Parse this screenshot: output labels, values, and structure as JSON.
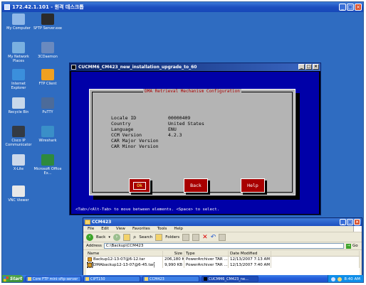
{
  "rdp": {
    "title": "172.42.1.101 - 원격 데스크톱"
  },
  "desktop_icons": [
    {
      "label": "My Computer",
      "icon": "computer-icon",
      "color": "#8fb8e8"
    },
    {
      "label": "SFTP Server.exe",
      "icon": "sftp-icon",
      "color": "#2b2b2b"
    },
    {
      "label": "My Network Places",
      "icon": "network-icon",
      "color": "#7ab0e0"
    },
    {
      "label": "3CDaemon",
      "icon": "daemon-icon",
      "color": "#6a8abf"
    },
    {
      "label": "Internet Explorer",
      "icon": "ie-icon",
      "color": "#3b8fdc"
    },
    {
      "label": "FTP Client",
      "icon": "ftp-icon",
      "color": "#f0a020"
    },
    {
      "label": "Recycle Bin",
      "icon": "recycle-bin-icon",
      "color": "#c8d8ea"
    },
    {
      "label": "PuTTY",
      "icon": "putty-icon",
      "color": "#4c6b9a"
    },
    {
      "label": "Cisco IP Communicator",
      "icon": "cisco-phone-icon",
      "color": "#333a44"
    },
    {
      "label": "Wireshark",
      "icon": "wireshark-icon",
      "color": "#3a8fc8"
    },
    {
      "label": "X-Lite",
      "icon": "xlite-icon",
      "color": "#ccd8ea"
    },
    {
      "label": "Microsoft Office Ex...",
      "icon": "excel-icon",
      "color": "#2e8a3e"
    },
    {
      "label": "VNC Viewer",
      "icon": "vnc-icon",
      "color": "#e8e8e8"
    }
  ],
  "console": {
    "title": "CUCMM6_CM423_new_installation_upgrade_to_60",
    "dialog_title": "DMA Retrieval Mechanism Configuration",
    "fields": [
      {
        "key": "Locale ID",
        "value": "00000409"
      },
      {
        "key": "Country",
        "value": "United States"
      },
      {
        "key": "Language",
        "value": "ENU"
      },
      {
        "key": "CCM Version",
        "value": "4.2.3"
      },
      {
        "key": "CAR Major Version",
        "value": ""
      },
      {
        "key": "CAR Minor Version",
        "value": ""
      }
    ],
    "buttons": {
      "ok": "Ok",
      "back": "Back",
      "help": "Help"
    },
    "footer": "<Tab>/<Alt-Tab> to move between elements. <Space> to select."
  },
  "explorer": {
    "title": "CCM423",
    "menu": [
      "File",
      "Edit",
      "View",
      "Favorites",
      "Tools",
      "Help"
    ],
    "toolbar": {
      "back": "Back",
      "search": "Search",
      "folders": "Folders"
    },
    "address_label": "Address",
    "address_value": "C:\\Backup\\CCM423",
    "go_label": "Go",
    "columns": [
      "Name",
      "Size",
      "Type",
      "Date Modified"
    ],
    "files": [
      {
        "name": "Backup12-13-07@6-12.tar",
        "size": "206,180 KB",
        "type": "PowerArchiver TAR ...",
        "date": "12/13/2007 7:13 AM"
      },
      {
        "name": "DMAbackup12-13-07@6-45.tar",
        "size": "9,990 KB",
        "type": "PowerArchiver TAR ...",
        "date": "12/13/2007 7:40 AM"
      }
    ]
  },
  "taskbar": {
    "start": "Start",
    "tasks": [
      "Core FTP mini-sftp-server",
      "CIPT150",
      "CCM423",
      "CUCMM6_CM423_ne..."
    ],
    "clock": "8:40 AM"
  }
}
